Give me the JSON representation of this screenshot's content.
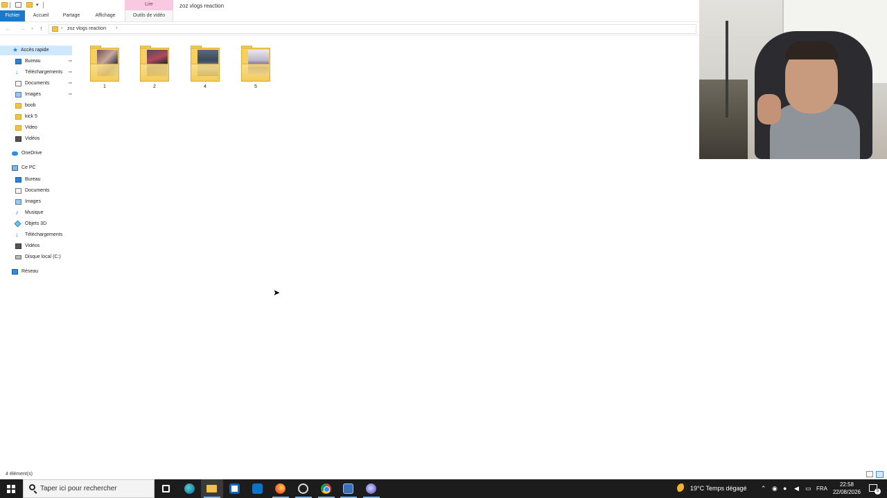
{
  "window": {
    "title": "zoz vlogs reaction",
    "contextual_group": "Lire"
  },
  "ribbon": {
    "tabs": [
      "Fichier",
      "Accueil",
      "Partage",
      "Affichage",
      "Outils de vidéo"
    ],
    "active_tab": "Fichier"
  },
  "address": {
    "breadcrumb": [
      "zoz vlogs reaction"
    ],
    "chevron": "›"
  },
  "nav": {
    "quick_access": {
      "label": "Accès rapide",
      "items": [
        {
          "label": "Bureau",
          "icon": "desktop-icon",
          "pinned": true
        },
        {
          "label": "Téléchargements",
          "icon": "download-icon",
          "pinned": true
        },
        {
          "label": "Documents",
          "icon": "document-icon",
          "pinned": true
        },
        {
          "label": "Images",
          "icon": "image-icon",
          "pinned": true
        },
        {
          "label": "boob",
          "icon": "folder-icon",
          "pinned": false
        },
        {
          "label": "kick 5",
          "icon": "folder-icon",
          "pinned": false
        },
        {
          "label": "Video",
          "icon": "folder-icon",
          "pinned": false
        },
        {
          "label": "Vidéos",
          "icon": "video-icon",
          "pinned": false
        }
      ]
    },
    "onedrive": "OneDrive",
    "this_pc": {
      "label": "Ce PC",
      "items": [
        {
          "label": "Bureau",
          "icon": "desktop-icon"
        },
        {
          "label": "Documents",
          "icon": "document-icon"
        },
        {
          "label": "Images",
          "icon": "image-icon"
        },
        {
          "label": "Musique",
          "icon": "music-icon"
        },
        {
          "label": "Objets 3D",
          "icon": "3d-objects-icon"
        },
        {
          "label": "Téléchargements",
          "icon": "download-icon"
        },
        {
          "label": "Vidéos",
          "icon": "video-icon"
        },
        {
          "label": "Disque local (C:)",
          "icon": "disk-icon"
        }
      ]
    },
    "network": "Réseau",
    "pin_glyph": "⊸"
  },
  "content": {
    "folders": [
      {
        "name": "1"
      },
      {
        "name": "2"
      },
      {
        "name": "4"
      },
      {
        "name": "5"
      }
    ]
  },
  "status": {
    "item_count": "4 élément(s)"
  },
  "taskbar": {
    "search_placeholder": "Taper ici pour rechercher",
    "pinned_apps": [
      "task-view",
      "edge",
      "file-explorer",
      "microsoft-store",
      "outlook",
      "firefox",
      "obs",
      "chrome",
      "app",
      "app"
    ],
    "active_app": "file-explorer"
  },
  "tray": {
    "weather": "19°C  Temps dégagé",
    "chevron": "⌃",
    "language": "FRA",
    "time": "22:58",
    "date": "22/08/2026",
    "notifications": "5"
  },
  "colors": {
    "accent": "#1979ca",
    "selection": "#cde8ff",
    "contextual_tab": "#f9c9e2",
    "taskbar": "#1c1c1c",
    "folder": "#f6cf5c"
  }
}
